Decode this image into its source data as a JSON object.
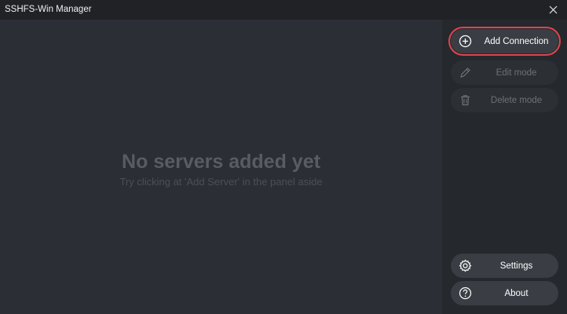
{
  "window": {
    "title": "SSHFS-Win Manager"
  },
  "main": {
    "empty_title": "No servers added yet",
    "empty_subtitle": "Try clicking at 'Add Server' in the panel aside"
  },
  "sidebar": {
    "add_connection": "Add Connection",
    "edit_mode": "Edit mode",
    "delete_mode": "Delete mode",
    "settings": "Settings",
    "about": "About"
  },
  "colors": {
    "highlight": "#e0454c",
    "background": "#2b2e34",
    "sidebar": "#25282d"
  },
  "icons": [
    "close-icon",
    "plus-circle-icon",
    "pencil-icon",
    "trash-icon",
    "gear-icon",
    "question-circle-icon"
  ]
}
